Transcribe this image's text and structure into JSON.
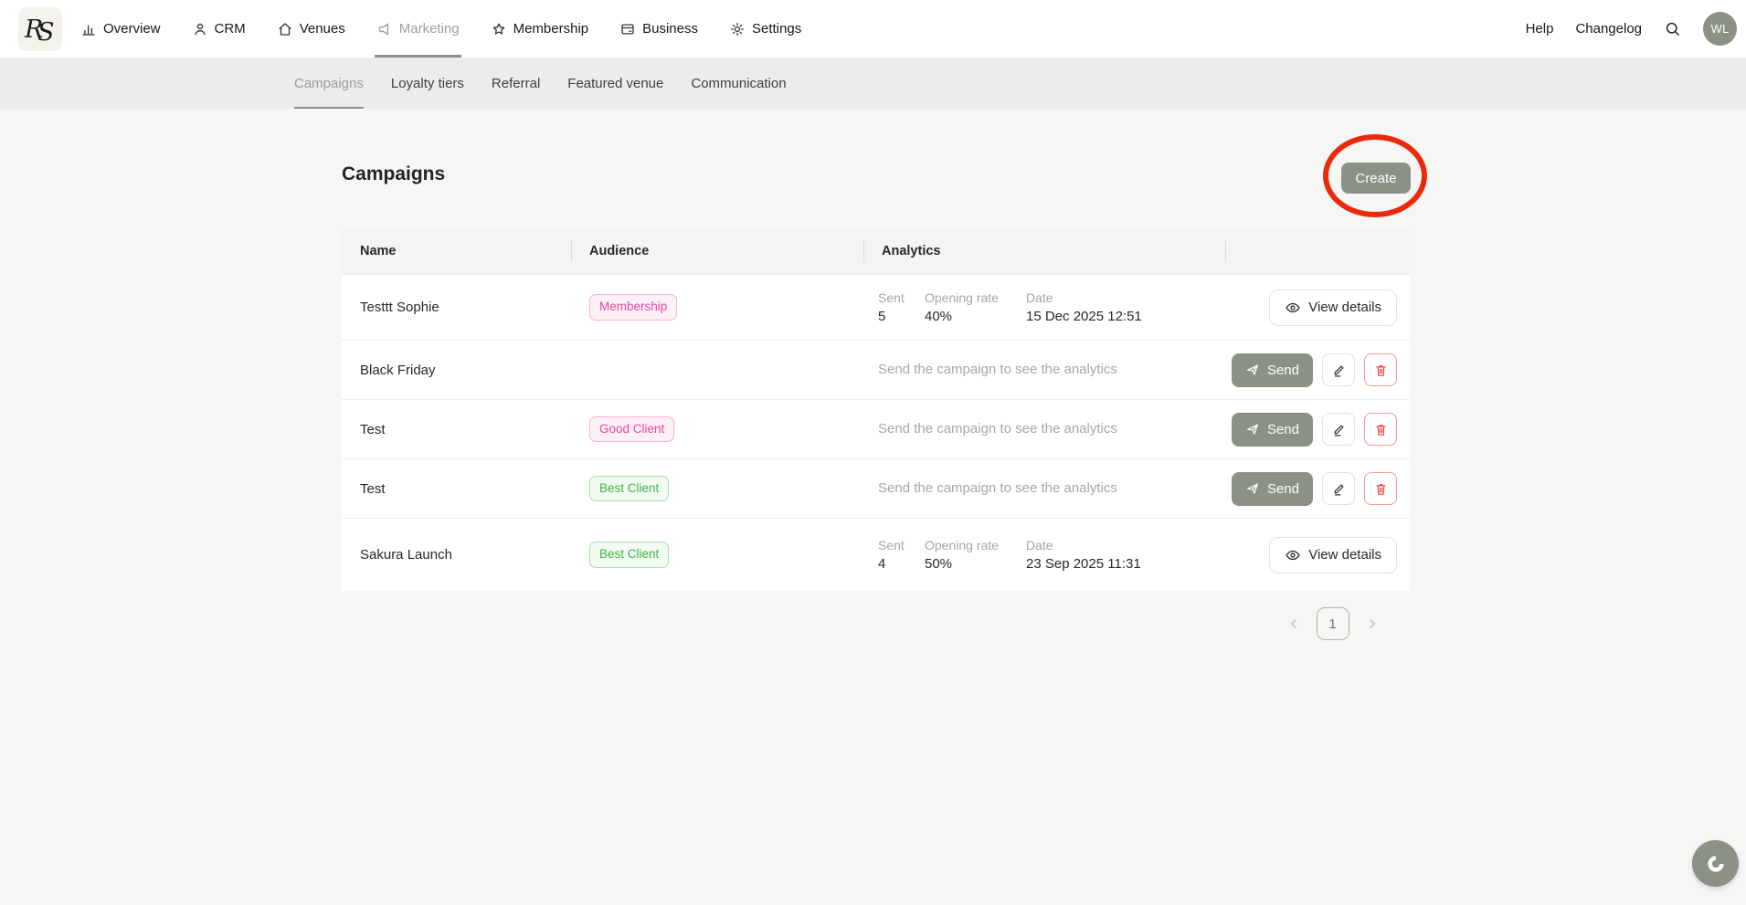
{
  "nav": {
    "items": [
      {
        "label": "Overview",
        "icon": "bar-chart-icon",
        "active": false
      },
      {
        "label": "CRM",
        "icon": "person-icon",
        "active": false
      },
      {
        "label": "Venues",
        "icon": "home-icon",
        "active": false
      },
      {
        "label": "Marketing",
        "icon": "megaphone-icon",
        "active": true
      },
      {
        "label": "Membership",
        "icon": "star-icon",
        "active": false
      },
      {
        "label": "Business",
        "icon": "card-icon",
        "active": false
      },
      {
        "label": "Settings",
        "icon": "gear-icon",
        "active": false
      }
    ],
    "help": "Help",
    "changelog": "Changelog",
    "avatar_initials": "WL"
  },
  "tabs": [
    {
      "label": "Campaigns",
      "active": true
    },
    {
      "label": "Loyalty tiers",
      "active": false
    },
    {
      "label": "Referral",
      "active": false
    },
    {
      "label": "Featured venue",
      "active": false
    },
    {
      "label": "Communication",
      "active": false
    }
  ],
  "page": {
    "title": "Campaigns",
    "create_label": "Create"
  },
  "table": {
    "columns": {
      "name": "Name",
      "audience": "Audience",
      "analytics": "Analytics"
    },
    "labels": {
      "sent": "Sent",
      "opening_rate": "Opening rate",
      "date": "Date",
      "no_analytics": "Send the campaign to see the analytics",
      "view_details": "View details",
      "send": "Send"
    },
    "rows": [
      {
        "name": "Testtt Sophie",
        "audience": "Membership",
        "audience_style": "pink",
        "sent": "5",
        "opening_rate": "40%",
        "date": "15 Dec 2025 12:51",
        "action": "view"
      },
      {
        "name": "Black Friday",
        "audience": "",
        "audience_style": "none",
        "action": "send"
      },
      {
        "name": "Test",
        "audience": "Good Client",
        "audience_style": "pink",
        "action": "send"
      },
      {
        "name": "Test",
        "audience": "Best Client",
        "audience_style": "green",
        "action": "send"
      },
      {
        "name": "Sakura Launch",
        "audience": "Best Client",
        "audience_style": "green",
        "sent": "4",
        "opening_rate": "50%",
        "date": "23 Sep 2025 11:31",
        "action": "view"
      }
    ]
  },
  "pagination": {
    "current_page": "1"
  },
  "colors": {
    "accent_olive": "#8b9184",
    "active_text": "#9aa096",
    "badge_pink": "#e9489b",
    "badge_green": "#44b04e",
    "danger_red": "#ef4444",
    "annotation_red": "#ea2a0c",
    "page_background": "#f6f6f5",
    "tabbar_background": "#ececeb"
  }
}
